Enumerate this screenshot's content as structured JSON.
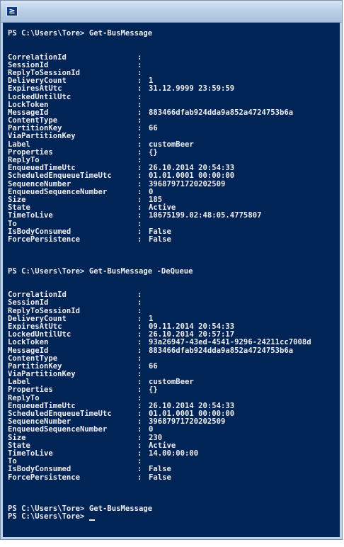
{
  "blocks": [
    {
      "prompt": "PS C:\\Users\\Tore>",
      "command": "Get-BusMessage",
      "properties": [
        {
          "key": "CorrelationId",
          "value": ""
        },
        {
          "key": "SessionId",
          "value": ""
        },
        {
          "key": "ReplyToSessionId",
          "value": ""
        },
        {
          "key": "DeliveryCount",
          "value": "1"
        },
        {
          "key": "ExpiresAtUtc",
          "value": "31.12.9999 23:59:59"
        },
        {
          "key": "LockedUntilUtc",
          "value": ""
        },
        {
          "key": "LockToken",
          "value": ""
        },
        {
          "key": "MessageId",
          "value": "883466dfab924dda9a852a4724753b6a"
        },
        {
          "key": "ContentType",
          "value": ""
        },
        {
          "key": "PartitionKey",
          "value": "66"
        },
        {
          "key": "ViaPartitionKey",
          "value": ""
        },
        {
          "key": "Label",
          "value": "customBeer"
        },
        {
          "key": "Properties",
          "value": "{}"
        },
        {
          "key": "ReplyTo",
          "value": ""
        },
        {
          "key": "EnqueuedTimeUtc",
          "value": "26.10.2014 20:54:33"
        },
        {
          "key": "ScheduledEnqueueTimeUtc",
          "value": "01.01.0001 00:00:00"
        },
        {
          "key": "SequenceNumber",
          "value": "39687971720202509"
        },
        {
          "key": "EnqueuedSequenceNumber",
          "value": "0"
        },
        {
          "key": "Size",
          "value": "185"
        },
        {
          "key": "State",
          "value": "Active"
        },
        {
          "key": "TimeToLive",
          "value": "10675199.02:48:05.4775807"
        },
        {
          "key": "To",
          "value": ""
        },
        {
          "key": "IsBodyConsumed",
          "value": "False"
        },
        {
          "key": "ForcePersistence",
          "value": "False"
        }
      ]
    },
    {
      "prompt": "PS C:\\Users\\Tore>",
      "command": "Get-BusMessage -DeQueue",
      "properties": [
        {
          "key": "CorrelationId",
          "value": ""
        },
        {
          "key": "SessionId",
          "value": ""
        },
        {
          "key": "ReplyToSessionId",
          "value": ""
        },
        {
          "key": "DeliveryCount",
          "value": "1"
        },
        {
          "key": "ExpiresAtUtc",
          "value": "09.11.2014 20:54:33"
        },
        {
          "key": "LockedUntilUtc",
          "value": "26.10.2014 20:57:17"
        },
        {
          "key": "LockToken",
          "value": "93a26947-43ed-4541-9296-24211cc7008d"
        },
        {
          "key": "MessageId",
          "value": "883466dfab924dda9a852a4724753b6a"
        },
        {
          "key": "ContentType",
          "value": ""
        },
        {
          "key": "PartitionKey",
          "value": "66"
        },
        {
          "key": "ViaPartitionKey",
          "value": ""
        },
        {
          "key": "Label",
          "value": "customBeer"
        },
        {
          "key": "Properties",
          "value": "{}"
        },
        {
          "key": "ReplyTo",
          "value": ""
        },
        {
          "key": "EnqueuedTimeUtc",
          "value": "26.10.2014 20:54:33"
        },
        {
          "key": "ScheduledEnqueueTimeUtc",
          "value": "01.01.0001 00:00:00"
        },
        {
          "key": "SequenceNumber",
          "value": "39687971720202509"
        },
        {
          "key": "EnqueuedSequenceNumber",
          "value": "0"
        },
        {
          "key": "Size",
          "value": "230"
        },
        {
          "key": "State",
          "value": "Active"
        },
        {
          "key": "TimeToLive",
          "value": "14.00:00:00"
        },
        {
          "key": "To",
          "value": ""
        },
        {
          "key": "IsBodyConsumed",
          "value": "False"
        },
        {
          "key": "ForcePersistence",
          "value": "False"
        }
      ]
    }
  ],
  "tail": [
    {
      "prompt": "PS C:\\Users\\Tore>",
      "command": "Get-BusMessage"
    },
    {
      "prompt": "PS C:\\Users\\Tore>",
      "command": ""
    }
  ],
  "separator": ":",
  "colors": {
    "console_background": "#012456",
    "console_text": "#eeedf0",
    "titlebar": "#b7cde4"
  },
  "window": {
    "icon": "powershell-icon",
    "icon_glyph": "≥"
  }
}
